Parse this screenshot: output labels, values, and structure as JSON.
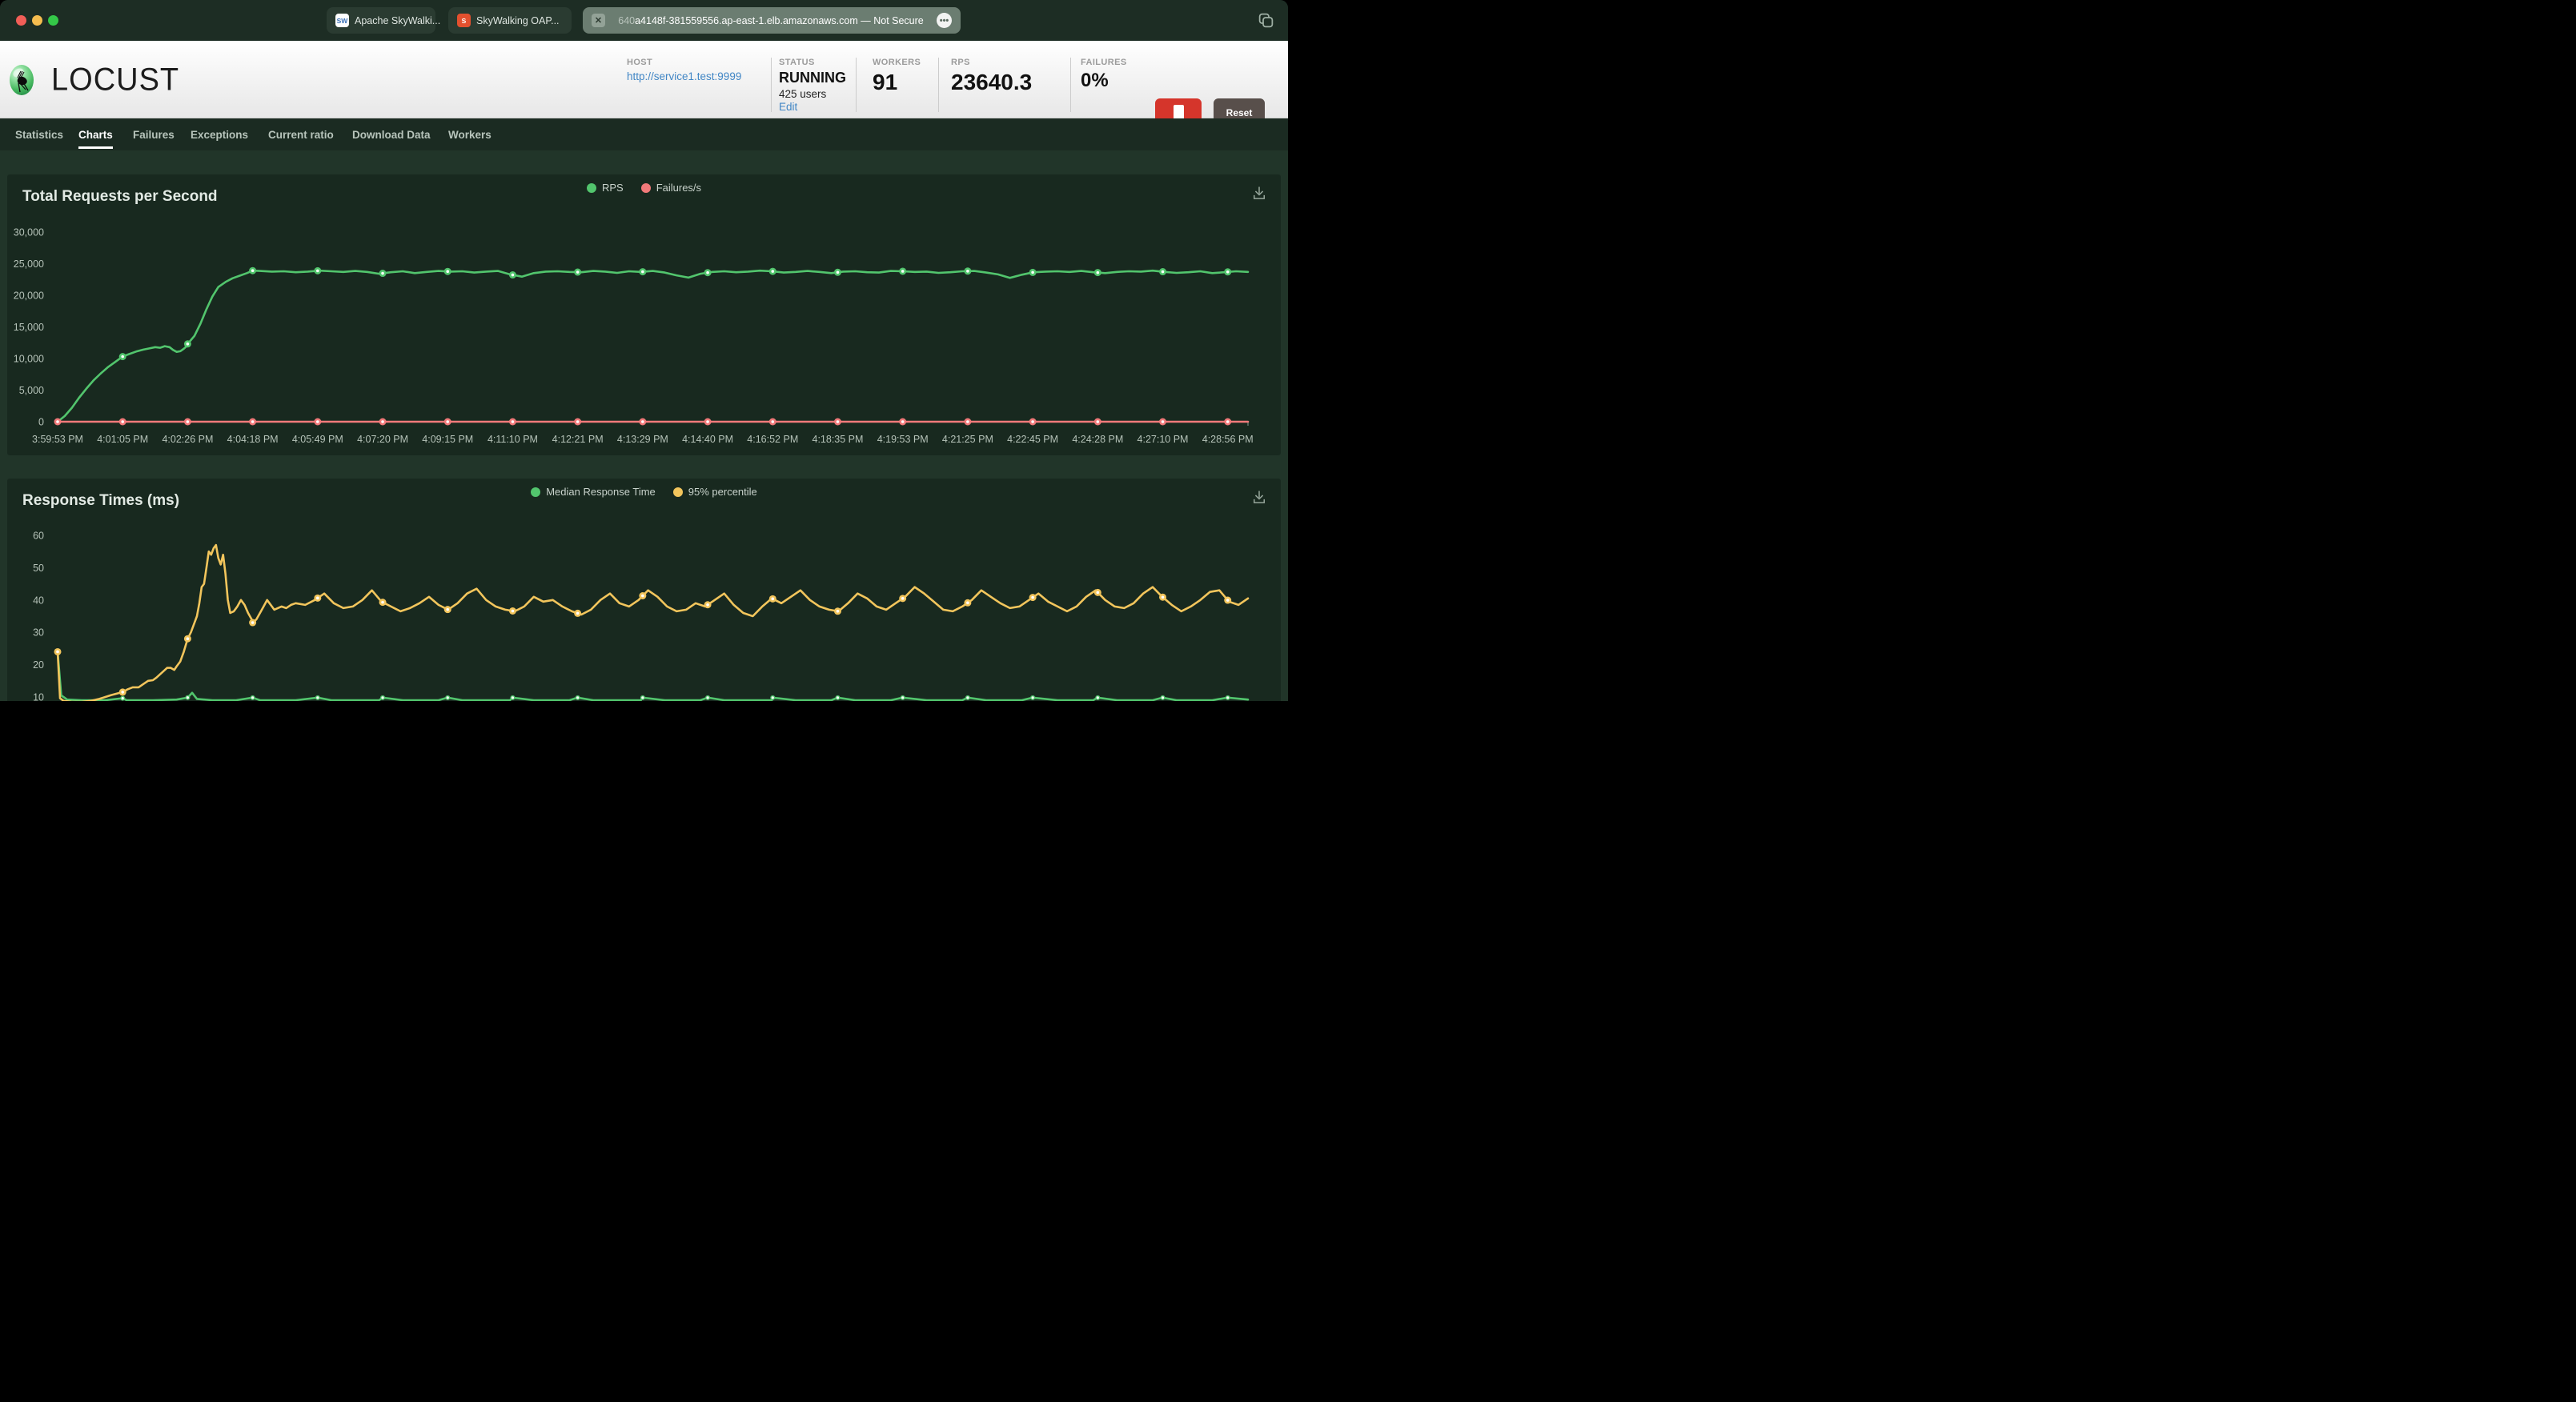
{
  "browser": {
    "tabs": [
      {
        "label": "Apache SkyWalki...",
        "favicon_text": "SW",
        "favicon_bg": "#ffffff",
        "favicon_color": "#3b71b8"
      },
      {
        "label": "SkyWalking OAP...",
        "favicon_text": "S",
        "favicon_bg": "#e4502e",
        "favicon_color": "#ffffff"
      },
      {
        "dim_prefix": "640",
        "label": "a4148f-381559556.ap-east-1.elb.amazonaws.com — Not Secure",
        "close_glyph": "✕",
        "more_glyph": "•••"
      }
    ]
  },
  "header": {
    "brand": "LOCUST",
    "host": {
      "label": "HOST",
      "url": "http://service1.test:9999"
    },
    "status": {
      "label": "STATUS",
      "state": "RUNNING",
      "users": "425 users",
      "edit": "Edit"
    },
    "workers": {
      "label": "WORKERS",
      "value": "91"
    },
    "rps": {
      "label": "RPS",
      "value": "23640.3"
    },
    "failures": {
      "label": "FAILURES",
      "value": "0%"
    },
    "stop_button": "STOP",
    "reset_button": "Reset Stats",
    "link_color": "#4186c5"
  },
  "nav": {
    "items": [
      "Statistics",
      "Charts",
      "Failures",
      "Exceptions",
      "Current ratio",
      "Download Data",
      "Workers"
    ],
    "active": "Charts"
  },
  "chart_data": [
    {
      "type": "line",
      "title": "Total Requests per Second",
      "legend": [
        "RPS",
        "Failures/s"
      ],
      "ylim": [
        0,
        30000
      ],
      "y_tick_labels": [
        "0",
        "5,000",
        "10,000",
        "15,000",
        "20,000",
        "25,000",
        "30,000"
      ],
      "y_tick_values": [
        0,
        5000,
        10000,
        15000,
        20000,
        25000,
        30000
      ],
      "x_labels": [
        "3:59:53 PM",
        "4:01:05 PM",
        "4:02:26 PM",
        "4:04:18 PM",
        "4:05:49 PM",
        "4:07:20 PM",
        "4:09:15 PM",
        "4:11:10 PM",
        "4:12:21 PM",
        "4:13:29 PM",
        "4:14:40 PM",
        "4:16:52 PM",
        "4:18:35 PM",
        "4:19:53 PM",
        "4:21:25 PM",
        "4:22:45 PM",
        "4:24:28 PM",
        "4:27:10 PM",
        "4:28:56 PM"
      ],
      "grid": false,
      "legend_position": "top-center",
      "series": [
        {
          "name": "RPS",
          "color": "#52c56d",
          "marker_radius": 4.5,
          "marker_at_start": false,
          "points": [
            [
              0,
              0
            ],
            [
              0.006,
              900
            ],
            [
              0.012,
              2200
            ],
            [
              0.018,
              3800
            ],
            [
              0.024,
              5200
            ],
            [
              0.03,
              6500
            ],
            [
              0.036,
              7600
            ],
            [
              0.042,
              8600
            ],
            [
              0.048,
              9400
            ],
            [
              0.0546,
              10300
            ],
            [
              0.06,
              10700
            ],
            [
              0.066,
              11100
            ],
            [
              0.072,
              11400
            ],
            [
              0.077,
              11600
            ],
            [
              0.082,
              11800
            ],
            [
              0.086,
              11700
            ],
            [
              0.09,
              11950
            ],
            [
              0.094,
              11800
            ],
            [
              0.097,
              11350
            ],
            [
              0.1,
              11050
            ],
            [
              0.103,
              11150
            ],
            [
              0.106,
              11550
            ],
            [
              0.109,
              12050
            ],
            [
              0.1092,
              12300
            ],
            [
              0.115,
              13600
            ],
            [
              0.12,
              15500
            ],
            [
              0.125,
              17800
            ],
            [
              0.13,
              19800
            ],
            [
              0.135,
              21300
            ],
            [
              0.141,
              22100
            ],
            [
              0.147,
              22700
            ],
            [
              0.153,
              23100
            ],
            [
              0.159,
              23500
            ],
            [
              0.1638,
              23900
            ]
          ],
          "tail": {
            "start": 0.17,
            "step": 0.01,
            "values": [
              23850,
              23750,
              23800,
              23650,
              23750,
              23900,
              23800,
              23700,
              23850,
              23700,
              23400,
              23650,
              23800,
              23500,
              23700,
              23850,
              23750,
              23800,
              23600,
              23750,
              23850,
              23300,
              22950,
              23500,
              23750,
              23800,
              23700,
              23650,
              23850,
              23750,
              23550,
              23800,
              23700,
              23850,
              23600,
              23150,
              22800,
              23400,
              23700,
              23800,
              23650,
              23750,
              23900,
              23800,
              23600,
              23700,
              23850,
              23700,
              23500,
              23750,
              23800,
              23650,
              23600,
              23850,
              23800,
              23700,
              23750,
              23550,
              23650,
              23800,
              23850,
              23600,
              23300,
              22750,
              23250,
              23650,
              23750,
              23800,
              23700,
              23850,
              23650,
              23500,
              23700,
              23800,
              23750,
              23900,
              23700,
              23550,
              23650,
              23800,
              23500,
              23650,
              23800,
              23700
            ]
          }
        },
        {
          "name": "Failures/s",
          "color": "#f17a7a",
          "marker_radius": 4.5,
          "marker_at_start": true,
          "constant": 0
        }
      ]
    },
    {
      "type": "line",
      "title": "Response Times (ms)",
      "legend": [
        "Median Response Time",
        "95% percentile"
      ],
      "ylim": [
        10,
        60
      ],
      "y_tick_labels": [
        "10",
        "20",
        "30",
        "40",
        "50",
        "60"
      ],
      "y_tick_values": [
        10,
        20,
        30,
        40,
        50,
        60
      ],
      "x_labels": [],
      "grid": false,
      "legend_position": "top-center",
      "series": [
        {
          "name": "Median Response Time",
          "color": "#52c56d",
          "marker_radius": 3,
          "marker_at_start": true,
          "points": [
            [
              0,
              24
            ],
            [
              0.003,
              10.5
            ],
            [
              0.008,
              9.2
            ],
            [
              0.02,
              9
            ],
            [
              0.04,
              9
            ],
            [
              0.0546,
              9.6
            ],
            [
              0.058,
              9
            ],
            [
              0.08,
              9
            ],
            [
              0.1,
              9.2
            ],
            [
              0.1092,
              9.8
            ],
            [
              0.113,
              11.3
            ],
            [
              0.117,
              9.4
            ],
            [
              0.13,
              9
            ],
            [
              0.15,
              9
            ],
            [
              0.1638,
              9.8
            ],
            [
              0.17,
              9
            ],
            [
              0.2,
              9
            ],
            [
              0.2184,
              9.8
            ],
            [
              0.23,
              9
            ],
            [
              0.27,
              9
            ],
            [
              0.273,
              9.8
            ],
            [
              0.29,
              9
            ],
            [
              0.32,
              9
            ],
            [
              0.3276,
              9.8
            ],
            [
              0.34,
              9
            ],
            [
              0.38,
              9
            ],
            [
              0.3822,
              9.8
            ],
            [
              0.4,
              9
            ],
            [
              0.43,
              9
            ],
            [
              0.4368,
              9.8
            ],
            [
              0.45,
              9
            ],
            [
              0.49,
              9
            ],
            [
              0.4914,
              9.8
            ],
            [
              0.51,
              9
            ],
            [
              0.54,
              9
            ],
            [
              0.546,
              9.8
            ],
            [
              0.56,
              9
            ],
            [
              0.6,
              9
            ],
            [
              0.6006,
              9.8
            ],
            [
              0.62,
              9
            ],
            [
              0.65,
              9
            ],
            [
              0.6552,
              9.8
            ],
            [
              0.67,
              9
            ],
            [
              0.7,
              9
            ],
            [
              0.7098,
              9.8
            ],
            [
              0.73,
              9
            ],
            [
              0.76,
              9
            ],
            [
              0.7644,
              9.8
            ],
            [
              0.78,
              9
            ],
            [
              0.81,
              9
            ],
            [
              0.819,
              9.8
            ],
            [
              0.84,
              9
            ],
            [
              0.87,
              9
            ],
            [
              0.8736,
              9.8
            ],
            [
              0.89,
              9
            ],
            [
              0.92,
              9
            ],
            [
              0.9282,
              9.8
            ],
            [
              0.94,
              9
            ],
            [
              0.97,
              9
            ],
            [
              0.9828,
              9.8
            ],
            [
              1,
              9.2
            ]
          ]
        },
        {
          "name": "95% percentile",
          "color": "#f2c55c",
          "marker_radius": 4.5,
          "marker_at_start": true,
          "points": [
            [
              0,
              24
            ],
            [
              0.002,
              9.6
            ],
            [
              0.005,
              8.8
            ],
            [
              0.012,
              8.5
            ],
            [
              0.02,
              8.5
            ],
            [
              0.028,
              8.8
            ],
            [
              0.035,
              9.4
            ],
            [
              0.04,
              10
            ],
            [
              0.045,
              10.6
            ],
            [
              0.05,
              11.1
            ],
            [
              0.0546,
              11.5
            ],
            [
              0.059,
              12.4
            ],
            [
              0.063,
              13
            ],
            [
              0.068,
              13
            ],
            [
              0.072,
              14
            ],
            [
              0.076,
              15
            ],
            [
              0.08,
              15.2
            ],
            [
              0.083,
              16
            ],
            [
              0.086,
              17
            ],
            [
              0.089,
              18
            ],
            [
              0.092,
              19
            ],
            [
              0.095,
              19
            ],
            [
              0.098,
              18.4
            ],
            [
              0.1,
              19.5
            ],
            [
              0.103,
              21
            ],
            [
              0.106,
              24
            ],
            [
              0.1092,
              28
            ],
            [
              0.112,
              30
            ],
            [
              0.115,
              33
            ],
            [
              0.117,
              35
            ],
            [
              0.119,
              39
            ],
            [
              0.121,
              44
            ],
            [
              0.123,
              45
            ],
            [
              0.125,
              50
            ],
            [
              0.127,
              55
            ],
            [
              0.129,
              54
            ],
            [
              0.131,
              56
            ],
            [
              0.133,
              57
            ],
            [
              0.135,
              53
            ],
            [
              0.137,
              51
            ],
            [
              0.139,
              54
            ],
            [
              0.141,
              48
            ],
            [
              0.143,
              40
            ],
            [
              0.145,
              36
            ],
            [
              0.148,
              36.5
            ],
            [
              0.151,
              38
            ],
            [
              0.154,
              40
            ],
            [
              0.157,
              38.5
            ],
            [
              0.16,
              36
            ],
            [
              0.163,
              34
            ],
            [
              0.1638,
              33
            ],
            [
              0.167,
              34
            ],
            [
              0.17,
              36
            ],
            [
              0.173,
              38
            ],
            [
              0.176,
              40
            ],
            [
              0.179,
              38.5
            ],
            [
              0.182,
              37
            ],
            [
              0.185,
              37.5
            ],
            [
              0.188,
              38
            ],
            [
              0.192,
              37.5
            ],
            [
              0.196,
              38.5
            ],
            [
              0.2,
              39
            ]
          ],
          "tail": {
            "start": 0.208,
            "step": 0.008,
            "values": [
              38.5,
              40,
              42,
              39,
              37.5,
              38,
              40,
              43,
              39.5,
              38,
              36.5,
              37.5,
              39,
              41,
              38.5,
              37,
              39,
              42,
              43.5,
              40,
              38,
              37,
              36.5,
              38,
              41,
              39.5,
              40,
              38,
              36.5,
              35.5,
              37,
              40,
              42,
              39,
              38,
              40,
              43,
              41,
              38,
              36.5,
              37,
              39,
              38,
              40,
              42,
              38.5,
              36,
              35,
              38,
              40.5,
              39,
              41,
              43,
              40,
              38,
              37,
              36.5,
              39,
              42,
              40.5,
              38,
              37,
              39,
              41,
              44,
              42,
              39.5,
              37,
              36.5,
              38,
              40,
              43,
              41,
              39,
              37.5,
              38,
              40,
              42,
              39.5,
              38,
              36.5,
              38,
              41,
              43,
              40,
              38,
              37.5,
              39,
              42,
              44,
              41,
              38.5,
              36.5,
              38,
              40,
              42.5,
              43,
              39.5,
              38.5,
              40.5
            ]
          }
        }
      ]
    }
  ]
}
